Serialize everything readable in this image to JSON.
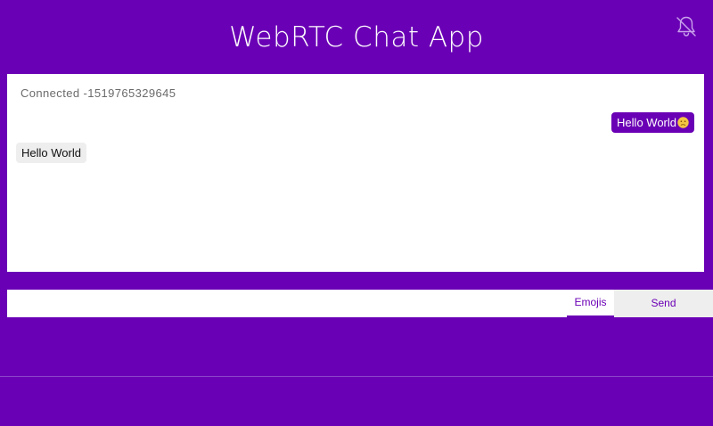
{
  "header": {
    "title": "WebRTC Chat App",
    "notification_icon": "bell-off-icon"
  },
  "chat": {
    "status": "Connected -1519765329645",
    "messages": [
      {
        "direction": "outgoing",
        "text": "Hello World",
        "emoji": "confused-face-emoji"
      },
      {
        "direction": "incoming",
        "text": "Hello World"
      }
    ]
  },
  "composer": {
    "input_value": "",
    "input_placeholder": "",
    "emojis_label": "Emojis",
    "send_label": "Send"
  },
  "colors": {
    "background": "#6a00b5",
    "accent": "#6a00b5",
    "surface": "#ffffff",
    "bubble_incoming": "#eeeeee",
    "send_button_bg": "#eeeeee",
    "emoji": "#f4c542"
  }
}
